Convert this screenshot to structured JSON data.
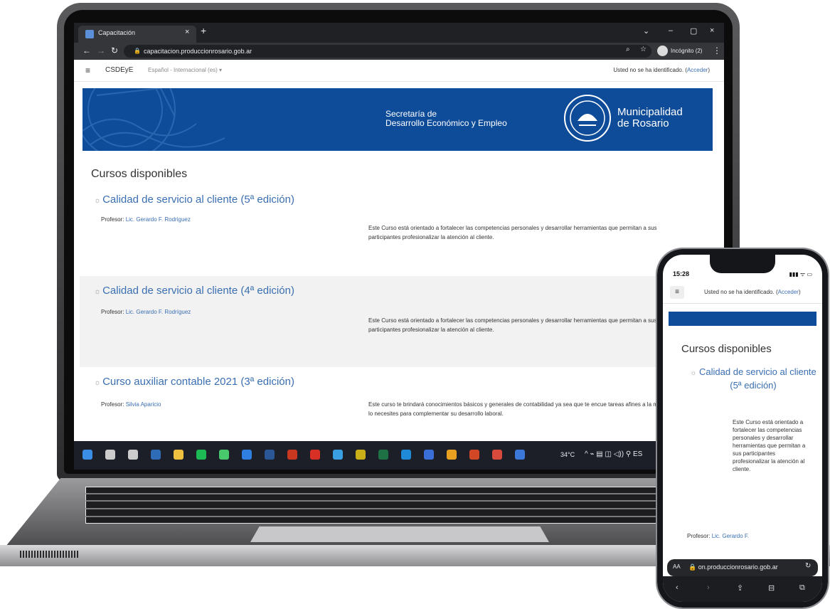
{
  "browser": {
    "tab_title": "Capacitación",
    "tab_close": "×",
    "new_tab": "+",
    "url": "capacitacion.produccionrosario.gob.ar",
    "incognito": "Incógnito (2)",
    "window_controls": [
      "⌄",
      "–",
      "▢",
      "×"
    ]
  },
  "site": {
    "brand": "CSDEyE",
    "language": "Español - Internacional (es) ▾",
    "login_prefix": "Usted no se ha identificado. (",
    "login_link": "Acceder",
    "login_suffix": ")",
    "banner": {
      "secretaria_line1": "Secretaría de",
      "secretaria_line2": "Desarrollo Económico y Empleo",
      "municipalidad_line1": "Municipalidad",
      "municipalidad_line2": "de Rosario"
    },
    "page_title": "Cursos disponibles",
    "profesor_label": "Profesor: ",
    "courses": [
      {
        "title": "Calidad de servicio al cliente (5ª edición)",
        "profesor": "Lic. Gerardo F. Rodriguez",
        "description": "Este Curso está orientado a fortalecer las competencias personales y desarrollar herramientas que permitan a sus participantes profesionalizar la atención al cliente."
      },
      {
        "title": "Calidad de servicio al cliente (4ª edición)",
        "profesor": "Lic. Gerardo F. Rodríguez",
        "description": "Este Curso está orientado a fortalecer las competencias personales y desarrollar herramientas que permitan a sus participantes profesionalizar la atención al cliente."
      },
      {
        "title": "Curso auxiliar contable 2021 (3ª edición)",
        "profesor": "Silvia Aparicio",
        "description": "Este curso te brindará conocimientos básicos y generales de contabilidad ya sea que te encue tareas afines a la misma o bien lo necesites para complementar su desarrollo laboral."
      }
    ]
  },
  "taskbar": {
    "weather": "34°C",
    "tray": "^ ⌁ ▤ ◫ ◁)) ⚲ ES",
    "apps": [
      "windows-start",
      "search",
      "task-view",
      "calculator",
      "file-explorer",
      "spotify",
      "dreamweaver",
      "photoshop",
      "word",
      "acrobat-ai",
      "acrobat",
      "app",
      "fireworks",
      "excel",
      "edge",
      "dropbox",
      "chrome",
      "powerpoint",
      "app-grid",
      "help"
    ],
    "app_colors": [
      "#3a8ee6",
      "#cccccc",
      "#cccccc",
      "#2f6cb8",
      "#f0c040",
      "#1db954",
      "#48c96b",
      "#2f7fe0",
      "#2b5797",
      "#c8371f",
      "#d93025",
      "#3a9fe0",
      "#c9b018",
      "#1e7145",
      "#1f8ad8",
      "#3a6fd8",
      "#e8a020",
      "#d24726",
      "#d84a3c",
      "#3b78d8"
    ]
  },
  "phone": {
    "time": "15:28",
    "status": "▮▮▮ ᯤ ▭",
    "burger": "≡",
    "login_prefix": "Usted no se ha identificado. (",
    "login_link": "Acceder",
    "login_suffix": ")",
    "page_title": "Cursos disponibles",
    "course_title": "Calidad de servicio al cliente (5ª edición)",
    "description": "Este Curso está orientado a fortalecer las competencias personales y desarrollar herramientas que permitan a sus participantes profesionalizar la atención al cliente.",
    "profesor_label": "Profesor: ",
    "profesor": "Lic. Gerardo F.",
    "url_aa": "AA",
    "url": "🔒 on.produccionrosario.gob.ar",
    "reload": "↻",
    "toolbar": [
      "‹",
      "›",
      "⇪",
      "⊟",
      "⧉"
    ]
  }
}
